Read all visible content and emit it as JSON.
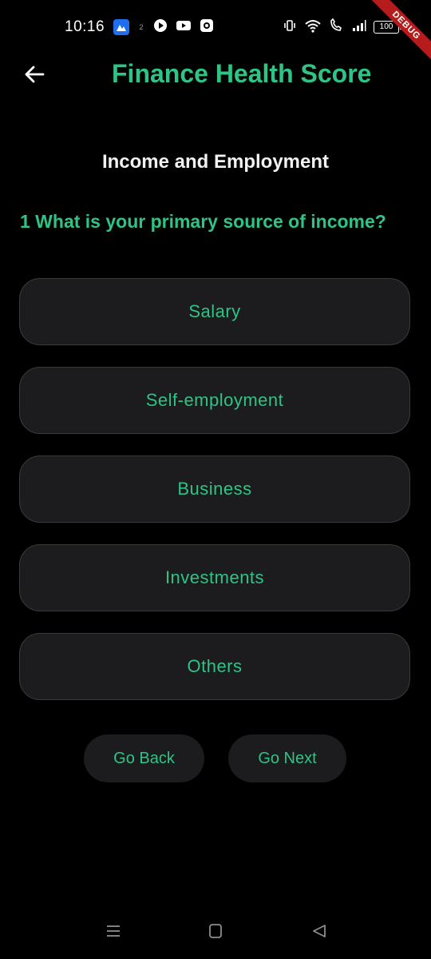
{
  "status_bar": {
    "time": "10:16",
    "notification_count": "2",
    "battery": "100",
    "icons": [
      "app-icon",
      "play-icon",
      "youtube-icon",
      "camera-icon",
      "vibrate-icon",
      "wifi-icon",
      "call-icon",
      "signal-icon",
      "battery-icon"
    ]
  },
  "debug_banner": "DEBUG",
  "app_bar": {
    "title": "Finance Health Score",
    "back_icon": "arrow-left-icon"
  },
  "section": {
    "title": "Income and Employment"
  },
  "question": {
    "text": "1 What is your primary source of income?"
  },
  "options": [
    {
      "label": "Salary"
    },
    {
      "label": "Self-employment"
    },
    {
      "label": "Business"
    },
    {
      "label": "Investments"
    },
    {
      "label": "Others"
    }
  ],
  "navigation": {
    "back_label": "Go Back",
    "next_label": "Go Next"
  },
  "system_nav": {
    "icons": [
      "recents-icon",
      "home-icon",
      "back-triangle-icon"
    ]
  },
  "colors": {
    "background": "#000000",
    "accent": "#2ec486",
    "surface": "#1c1c1e",
    "debug": "#b71c1c"
  }
}
